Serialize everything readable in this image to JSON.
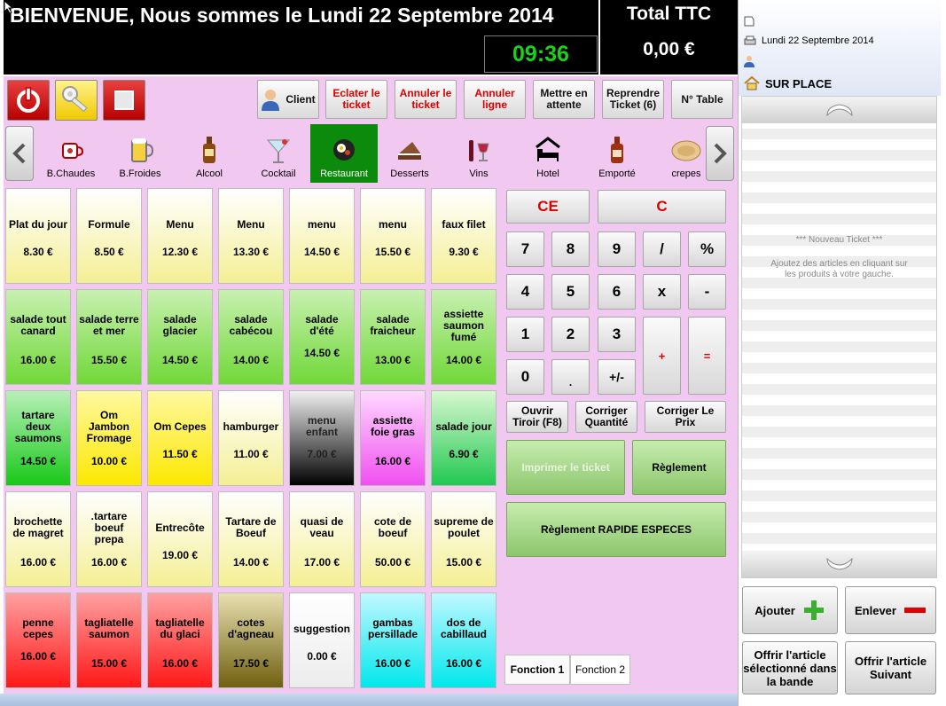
{
  "header": {
    "title": "BIENVENUE, Nous sommes le Lundi 22 Septembre 2014",
    "clock": "09:36",
    "total_label": "Total TTC",
    "total_value": "0,00 €"
  },
  "toolbar": {
    "power_icon": "power-icon",
    "keys_icon": "keys-icon",
    "stop_icon": "stop-icon",
    "client": "Client",
    "eclater": "Eclater le ticket",
    "annuler_ticket": "Annuler le ticket",
    "annuler_ligne": "Annuler ligne",
    "mettre_attente": "Mettre en attente",
    "reprendre": "Reprendre Ticket (6)",
    "table": "N° Table"
  },
  "categories": [
    {
      "label": "B.Chaudes",
      "icon": "hot-drink-icon"
    },
    {
      "label": "B.Froides",
      "icon": "beer-icon"
    },
    {
      "label": "Alcool",
      "icon": "bottle-icon"
    },
    {
      "label": "Cocktail",
      "icon": "cocktail-icon"
    },
    {
      "label": "Restaurant",
      "icon": "pan-icon"
    },
    {
      "label": "Desserts",
      "icon": "cake-icon"
    },
    {
      "label": "Vins",
      "icon": "wine-icon"
    },
    {
      "label": "Hotel",
      "icon": "bed-icon"
    },
    {
      "label": "Emporté",
      "icon": "takeaway-bottle-icon"
    },
    {
      "label": "crepes",
      "icon": "crepe-icon"
    }
  ],
  "products": [
    [
      {
        "name": "Plat du jour",
        "price": "8.30 €"
      },
      {
        "name": "Formule",
        "price": "8.50 €"
      },
      {
        "name": "Menu",
        "price": "12.30 €"
      },
      {
        "name": "Menu",
        "price": "13.30 €"
      },
      {
        "name": "menu",
        "price": "14.50 €"
      },
      {
        "name": "menu",
        "price": "15.50 €"
      },
      {
        "name": "faux filet",
        "price": "9.30 €"
      }
    ],
    [
      {
        "name": "salade tout canard",
        "price": "16.00 €"
      },
      {
        "name": "salade terre et mer",
        "price": "15.50 €"
      },
      {
        "name": "salade glacier",
        "price": "14.50 €"
      },
      {
        "name": "salade cabécou",
        "price": "14.00 €"
      },
      {
        "name": "salade d'été",
        "price": "14.50 €"
      },
      {
        "name": "salade fraicheur",
        "price": "13.00 €"
      },
      {
        "name": "assiette saumon fumé",
        "price": "14.00 €"
      }
    ],
    [
      {
        "name": "tartare deux saumons",
        "price": "14.50 €"
      },
      {
        "name": "Om Jambon Fromage",
        "price": "10.00 €"
      },
      {
        "name": "Om Cepes",
        "price": "11.50 €"
      },
      {
        "name": "hamburger",
        "price": "11.00 €"
      },
      {
        "name": "menu enfant",
        "price": "7.00 €"
      },
      {
        "name": "assiette foie gras",
        "price": "16.00 €"
      },
      {
        "name": "salade jour",
        "price": "6.90 €"
      }
    ],
    [
      {
        "name": "brochette de magret",
        "price": "16.00 €"
      },
      {
        "name": ".tartare boeuf prepa",
        "price": "16.00 €"
      },
      {
        "name": "Entrecôte",
        "price": "19.00 €"
      },
      {
        "name": "Tartare de Boeuf",
        "price": "14.00 €"
      },
      {
        "name": "quasi de veau",
        "price": "17.00 €"
      },
      {
        "name": "cote de boeuf",
        "price": "50.00 €"
      },
      {
        "name": "supreme de poulet",
        "price": "15.00 €"
      }
    ],
    [
      {
        "name": "penne cepes",
        "price": "16.00 €"
      },
      {
        "name": "tagliatelle saumon",
        "price": "15.00 €"
      },
      {
        "name": "tagliatelle du glaci",
        "price": "16.00 €"
      },
      {
        "name": "cotes d'agneau",
        "price": "17.50 €"
      },
      {
        "name": "suggestion",
        "price": "0.00 €"
      },
      {
        "name": "gambas persillade",
        "price": "16.00 €"
      },
      {
        "name": "dos de cabillaud",
        "price": "16.00 €"
      }
    ]
  ],
  "keypad": {
    "ce": "CE",
    "c": "C",
    "row1": [
      "7",
      "8",
      "9",
      "/",
      "%"
    ],
    "row2": [
      "4",
      "5",
      "6",
      "x",
      "-"
    ],
    "row3": [
      "1",
      "2",
      "3"
    ],
    "row4": [
      "0",
      ".",
      "+/-"
    ],
    "plus": "+",
    "equals": "=",
    "ouvrir": "Ouvrir Tiroir (F8)",
    "corriger_qte": "Corriger Quantité",
    "corriger_prix": "Corriger Le Prix",
    "imprimer": "Imprimer le ticket",
    "reglement": "Règlement",
    "reglement_rapide": "Règlement RAPIDE ESPECES",
    "fonction1": "Fonction 1",
    "fonction2": "Fonction 2"
  },
  "ticket": {
    "date": "Lundi 22 Septembre 2014",
    "mode": "SUR PLACE",
    "new_ticket": "*** Nouveau Ticket ***",
    "hint": "Ajoutez des articles en cliquant sur les produits à votre gauche.",
    "ajouter": "Ajouter",
    "enlever": "Enlever",
    "offrir_sel": "Offrir l'article sélectionné dans la bande",
    "offrir_suiv": "Offrir l'article Suivant"
  },
  "colors": {
    "pink_bg": "#f0c8f0",
    "active_cat": "#0c8a0c",
    "clock": "#19d219",
    "red_text": "#e00000"
  }
}
